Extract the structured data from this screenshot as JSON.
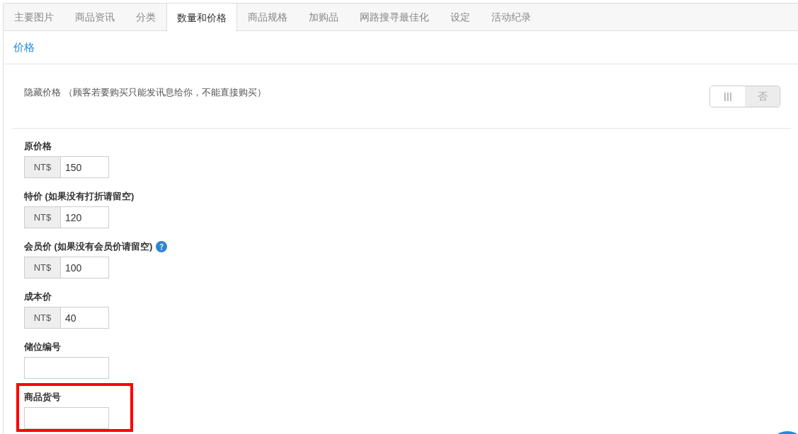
{
  "tabs": [
    {
      "label": "主要图片",
      "selected": false
    },
    {
      "label": "商品资讯",
      "selected": false
    },
    {
      "label": "分类",
      "selected": false
    },
    {
      "label": "数量和价格",
      "selected": true
    },
    {
      "label": "商品规格",
      "selected": false
    },
    {
      "label": "加购品",
      "selected": false
    },
    {
      "label": "网路搜寻最佳化",
      "selected": false
    },
    {
      "label": "设定",
      "selected": false
    },
    {
      "label": "活动纪录",
      "selected": false
    }
  ],
  "section": {
    "title": "价格"
  },
  "hide_price": {
    "label": "隐藏价格 （顾客若要购买只能发讯息给你，不能直接购买）",
    "toggle": {
      "on": false,
      "label": "否"
    }
  },
  "fields": [
    {
      "label": "原价格",
      "prefix": "NT$",
      "value": "150",
      "help": false,
      "highlighted": false
    },
    {
      "label": "特价 (如果没有打折请留空)",
      "prefix": "NT$",
      "value": "120",
      "help": false,
      "highlighted": false
    },
    {
      "label": "会员价 (如果没有会员价请留空)",
      "prefix": "NT$",
      "value": "100",
      "help": true,
      "highlighted": false
    },
    {
      "label": "成本价",
      "prefix": "NT$",
      "value": "40",
      "help": false,
      "highlighted": false
    },
    {
      "label": "储位编号",
      "help": false,
      "highlighted": false
    },
    {
      "label": "商品货号",
      "help": false,
      "highlighted": true
    }
  ]
}
